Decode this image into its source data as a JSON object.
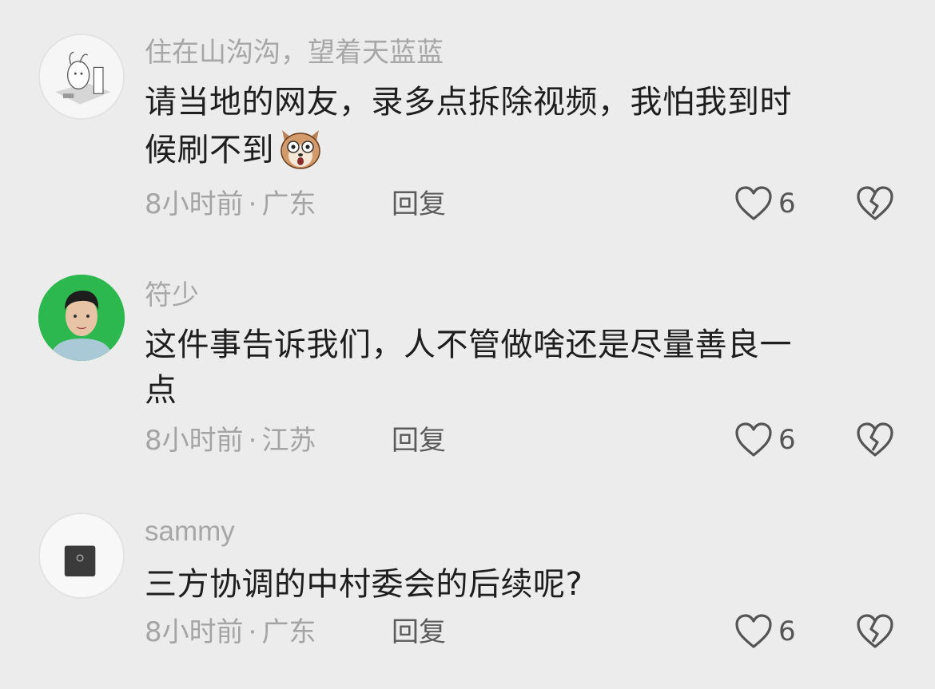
{
  "comments": [
    {
      "username": "住在山沟沟，望着天蓝蓝",
      "text_line1": "请当地的网友，录多点拆除视频，我怕我到时",
      "text_line2": "候刷不到",
      "emoji": "shocked-dog-emoji",
      "meta": "8小时前",
      "location": "广东",
      "reply_label": "回复",
      "likes": "6"
    },
    {
      "username": "符少",
      "text_line1": "这件事告诉我们，人不管做啥还是尽量善良一",
      "text_line2": "点",
      "meta": "8小时前",
      "location": "江苏",
      "reply_label": "回复",
      "likes": "6"
    },
    {
      "username": "sammy",
      "text_line1": "三方协调的中村委会的后续呢?",
      "meta": "8小时前",
      "location": "广东",
      "reply_label": "回复",
      "likes": "6"
    }
  ],
  "icons": {
    "like": "heart-outline-icon",
    "dislike": "broken-heart-icon"
  },
  "colors": {
    "background": "#ececec",
    "username": "#a7a7a7",
    "text": "#1e1e1e",
    "meta": "#a4a4a4",
    "avatar2_bg": "#2db84f"
  }
}
